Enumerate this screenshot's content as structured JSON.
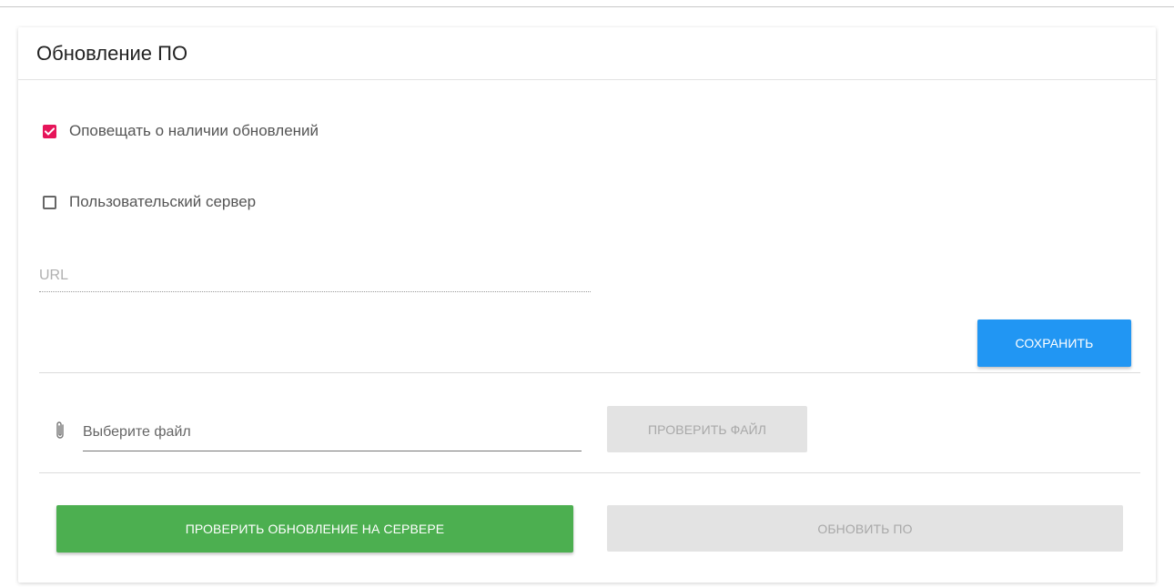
{
  "card": {
    "title": "Обновление ПО"
  },
  "options": {
    "notify_updates": {
      "label": "Оповещать о наличии обновлений",
      "checked": true
    },
    "custom_server": {
      "label": "Пользовательский сервер",
      "checked": false
    }
  },
  "url_field": {
    "placeholder": "URL",
    "value": ""
  },
  "buttons": {
    "save": "СОХРАНИТЬ",
    "check_file": "ПРОВЕРИТЬ ФАЙЛ",
    "check_server": "ПРОВЕРИТЬ ОБНОВЛЕНИЕ НА СЕРВЕРЕ",
    "update": "ОБНОВИТЬ ПО"
  },
  "file_picker": {
    "placeholder": "Выберите файл",
    "icon": "paperclip-icon"
  },
  "colors": {
    "checkbox_accent": "#e6155a",
    "save_button": "#2196f3",
    "server_button": "#4caf50",
    "disabled_button": "#e3e3e3"
  }
}
